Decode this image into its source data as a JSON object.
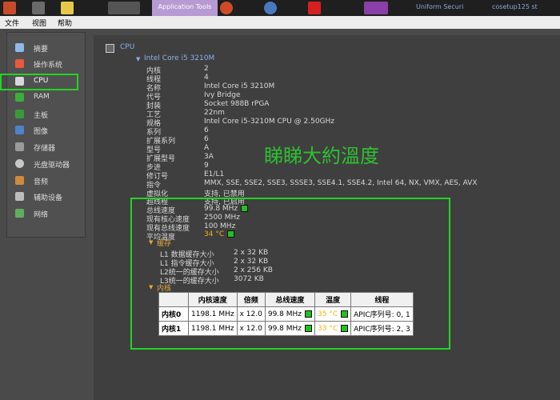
{
  "taskbar": {
    "app_tools_tab": "Application Tools",
    "right_texts": [
      "Uniform Securi",
      "cosetup125 st"
    ]
  },
  "menubar": {
    "items": [
      "文件",
      "视图",
      "帮助"
    ]
  },
  "sidebar": {
    "items": [
      {
        "label": "摘要",
        "icon": "summary-icon",
        "color": "#8fb8e8"
      },
      {
        "label": "操作系统",
        "icon": "windows-icon",
        "color": "#e85a3c"
      },
      {
        "label": "CPU",
        "icon": "cpu-icon",
        "color": "#d8d8d8",
        "selected": true
      },
      {
        "label": "RAM",
        "icon": "ram-icon",
        "color": "#3cae3c"
      },
      {
        "label": "主板",
        "icon": "motherboard-icon",
        "color": "#3a9a3a"
      },
      {
        "label": "图像",
        "icon": "graphics-icon",
        "color": "#4e82c9"
      },
      {
        "label": "存储器",
        "icon": "storage-icon",
        "color": "#9a9a9a"
      },
      {
        "label": "光盘驱动器",
        "icon": "optical-drive-icon",
        "color": "#c8c8c8"
      },
      {
        "label": "音频",
        "icon": "audio-icon",
        "color": "#d08a3c"
      },
      {
        "label": "辅助设备",
        "icon": "peripherals-icon",
        "color": "#bcbcbc"
      },
      {
        "label": "网络",
        "icon": "network-icon",
        "color": "#5fae5f"
      }
    ]
  },
  "cpu": {
    "root_label": "CPU",
    "model_label": "Intel Core i5 3210M",
    "props": [
      {
        "k": "内核",
        "v": "2"
      },
      {
        "k": "线程",
        "v": "4"
      },
      {
        "k": "名称",
        "v": "Intel Core i5 3210M"
      },
      {
        "k": "代号",
        "v": "Ivy Bridge"
      },
      {
        "k": "封装",
        "v": "Socket 988B rPGA"
      },
      {
        "k": "工艺",
        "v": "22nm"
      },
      {
        "k": "规格",
        "v": "Intel Core i5-3210M CPU @ 2.50GHz"
      },
      {
        "k": "系列",
        "v": "6"
      },
      {
        "k": "扩展系列",
        "v": "6"
      },
      {
        "k": "型号",
        "v": "A"
      },
      {
        "k": "扩展型号",
        "v": "3A"
      },
      {
        "k": "步进",
        "v": "9"
      },
      {
        "k": "修订号",
        "v": "E1/L1"
      },
      {
        "k": "指令",
        "v": "MMX, SSE, SSE2, SSE3, SSSE3, SSE4.1, SSE4.2, Intel 64, NX, VMX, AES, AVX"
      },
      {
        "k": "虚拟化",
        "v": "支持, 已禁用"
      },
      {
        "k": "超线程",
        "v": "支持, 已启用"
      }
    ],
    "bus": [
      {
        "k": "总线速度",
        "v": "99.8 MHz"
      },
      {
        "k": "现有核心速度",
        "v": "2500 MHz"
      },
      {
        "k": "现有总线速度",
        "v": "100 MHz"
      },
      {
        "k": "平均温度",
        "v": "34 °C"
      }
    ],
    "cache_title": "缓存",
    "cache": [
      {
        "k": "L1 数据缓存大小",
        "v": "2 x 32 KB"
      },
      {
        "k": "L1 指令缓存大小",
        "v": "2 x 32 KB"
      },
      {
        "k": "L2统一的缓存大小",
        "v": "2 x 256 KB"
      },
      {
        "k": "L3统一的缓存大小",
        "v": "3072 KB"
      }
    ],
    "cores_title": "内核",
    "core_table": {
      "headers": [
        "",
        "内核速度",
        "倍频",
        "总线速度",
        "温度",
        "线程"
      ],
      "rows": [
        {
          "name": "内核0",
          "speed": "1198.1 MHz",
          "mult": "x 12.0",
          "bus": "99.8 MHz",
          "temp": "35 °C",
          "threads": "APIC序列号: 0, 1"
        },
        {
          "name": "内核1",
          "speed": "1198.1 MHz",
          "mult": "x 12.0",
          "bus": "99.8 MHz",
          "temp": "33 °C",
          "threads": "APIC序列号: 2, 3"
        }
      ]
    }
  },
  "overlay_text": "睇睇大約溫度"
}
